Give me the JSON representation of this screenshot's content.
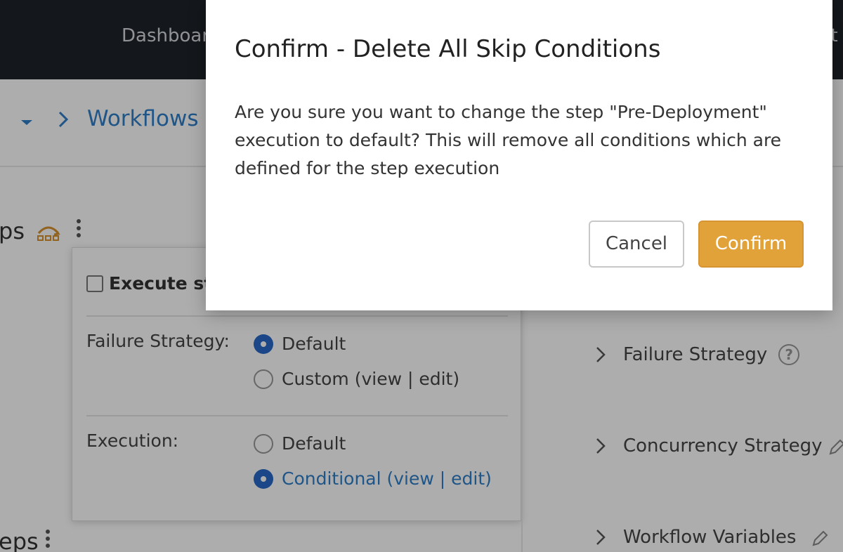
{
  "topnav": {
    "items": [
      {
        "label": "Dashboar"
      },
      {
        "label": "nt"
      }
    ]
  },
  "breadcrumb": {
    "items": [
      {
        "label": "Workflows"
      }
    ]
  },
  "main": {
    "section_top_title": "ps",
    "section_bottom_title": "eps",
    "panel": {
      "checkbox_label": "Execute ste",
      "checkbox_checked": false,
      "failure_strategy": {
        "label": "Failure Strategy:",
        "options": [
          {
            "label": "Default",
            "selected": true
          },
          {
            "label": "Custom (view | edit)",
            "selected": false
          }
        ]
      },
      "execution": {
        "label": "Execution:",
        "options": [
          {
            "label": "Default",
            "selected": false
          },
          {
            "label": "Conditional (view | edit)",
            "selected": true
          }
        ]
      }
    }
  },
  "right_panel": {
    "items": [
      {
        "label": "Failure Strategy",
        "icon": "help-icon",
        "help_glyph": "?"
      },
      {
        "label": "Concurrency Strategy",
        "icon": "pencil-icon"
      },
      {
        "label": "Workflow Variables",
        "icon": "pencil-icon"
      }
    ]
  },
  "modal": {
    "title": "Confirm - Delete All Skip Conditions",
    "message": "Are you sure you want to change the step \"Pre-Deployment\" execution to default? This will remove all conditions which are defined for the step execution",
    "cancel_label": "Cancel",
    "confirm_label": "Confirm"
  },
  "colors": {
    "nav_bg": "#1e2229",
    "link": "#2f7ec7",
    "radio_selected": "#2868c7",
    "confirm_button": "#e2a23a",
    "overlay": "rgba(0,0,0,0.32)"
  }
}
